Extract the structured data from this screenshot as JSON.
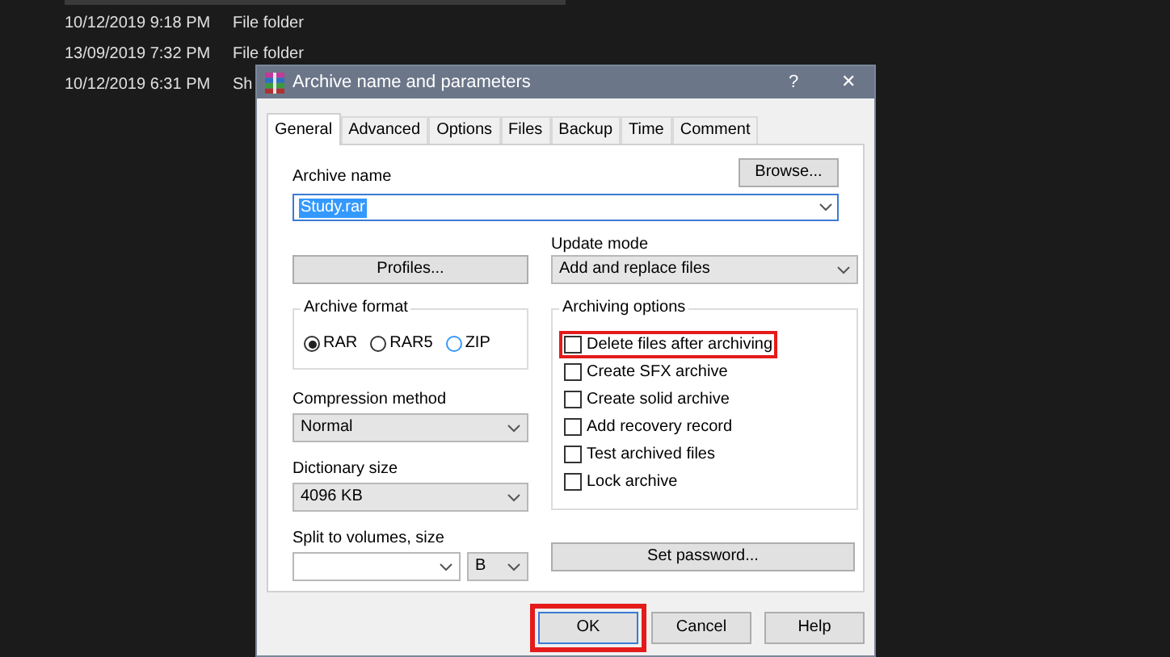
{
  "explorer_rows": [
    {
      "date": "10/12/2019 9:18 PM",
      "type": "File folder"
    },
    {
      "date": "13/09/2019 7:32 PM",
      "type": "File folder"
    },
    {
      "date": "10/12/2019 6:31 PM",
      "type": "Sh"
    }
  ],
  "dialog": {
    "title": "Archive name and parameters",
    "help": "?",
    "close": "✕"
  },
  "tabs": [
    {
      "label": "General",
      "selected": true
    },
    {
      "label": "Advanced",
      "selected": false
    },
    {
      "label": "Options",
      "selected": false
    },
    {
      "label": "Files",
      "selected": false
    },
    {
      "label": "Backup",
      "selected": false
    },
    {
      "label": "Time",
      "selected": false
    },
    {
      "label": "Comment",
      "selected": false
    }
  ],
  "archive_name": {
    "label": "Archive name",
    "value": "Study.rar",
    "browse": "Browse..."
  },
  "profiles": "Profiles...",
  "update_mode": {
    "label": "Update mode",
    "value": "Add and replace files"
  },
  "archive_format": {
    "label": "Archive format",
    "options": [
      {
        "label": "RAR",
        "selected": true
      },
      {
        "label": "RAR5",
        "selected": false
      },
      {
        "label": "ZIP",
        "selected": false
      }
    ]
  },
  "compression_method": {
    "label": "Compression method",
    "value": "Normal"
  },
  "dictionary_size": {
    "label": "Dictionary size",
    "value": "4096 KB"
  },
  "split": {
    "label": "Split to volumes, size",
    "unit": "B"
  },
  "archiving_options": {
    "label": "Archiving options",
    "options": [
      {
        "label": "Delete files after archiving",
        "checked": false,
        "highlighted": true
      },
      {
        "label": "Create SFX archive",
        "checked": false,
        "highlighted": false
      },
      {
        "label": "Create solid archive",
        "checked": false,
        "highlighted": false
      },
      {
        "label": "Add recovery record",
        "checked": false,
        "highlighted": false
      },
      {
        "label": "Test archived files",
        "checked": false,
        "highlighted": false
      },
      {
        "label": "Lock archive",
        "checked": false,
        "highlighted": false
      }
    ]
  },
  "set_password": "Set password...",
  "buttons": [
    {
      "label": "OK",
      "highlighted": true
    },
    {
      "label": "Cancel",
      "highlighted": false
    },
    {
      "label": "Help",
      "highlighted": false
    }
  ]
}
